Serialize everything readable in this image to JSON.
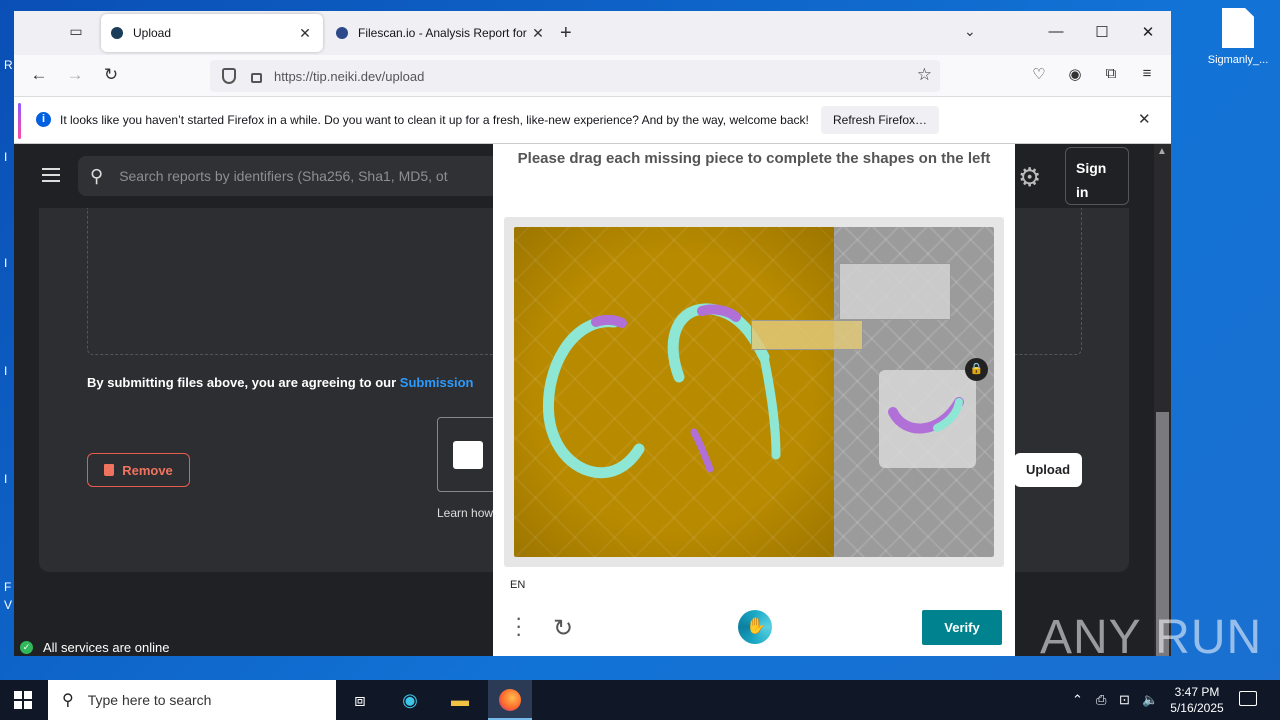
{
  "desktop": {
    "icon_label": "Sigmanly_...",
    "edge_letters": [
      "R",
      "I",
      "I",
      "I",
      "I",
      "F",
      "V"
    ]
  },
  "browser": {
    "tabs": [
      {
        "title": "Upload",
        "favicon_color": "#1c3d5a"
      },
      {
        "title": "Filescan.io - Analysis Report for",
        "favicon_color": "#2c4a8a"
      }
    ],
    "url": "https://tip.neiki.dev/upload",
    "notification": {
      "message": "It looks like you haven’t started Firefox in a while. Do you want to clean it up for a fresh, like-new experience? And by the way, welcome back!",
      "button": "Refresh Firefox…"
    }
  },
  "site": {
    "search_placeholder": "Search reports by identifiers (Sha256, Sha1, MD5, ot",
    "signin": "Sign in",
    "agreement_text": "By submitting files above, you are agreeing to our ",
    "agreement_link": "Submission",
    "remove_label": "Remove",
    "upload_label": "Upload",
    "learn_text": "Learn how",
    "status_text": "All services are online"
  },
  "captcha": {
    "prompt": "Please drag each missing piece to complete the shapes on the left",
    "language": "EN",
    "verify_label": "Verify",
    "colors": {
      "accent": "#00838f",
      "puzzle_bg": "#b88a00"
    }
  },
  "watermark": "ANY RUN",
  "taskbar": {
    "search_placeholder": "Type here to search",
    "time": "3:47 PM",
    "date": "5/16/2025"
  }
}
